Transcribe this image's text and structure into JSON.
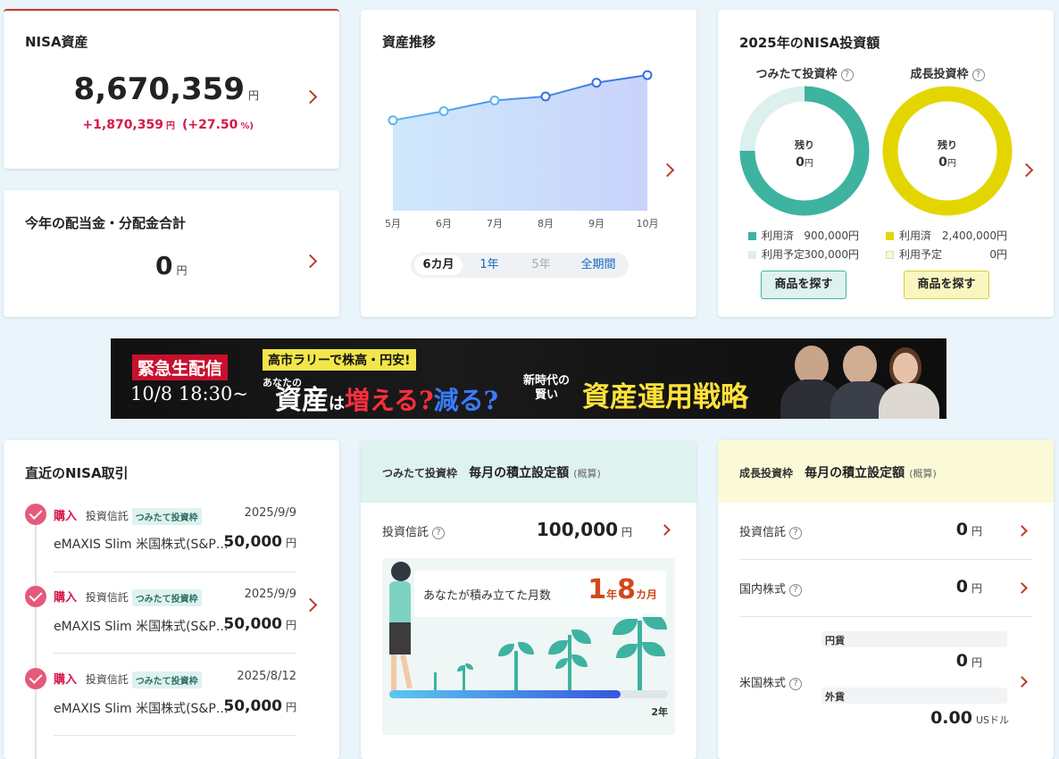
{
  "nisa_assets": {
    "title": "NISA資産",
    "amount": "8,670,359",
    "unit": "円",
    "gain": "+1,870,359",
    "gain_unit": "円",
    "gain_pct": "(+27.50",
    "gain_pct_unit": "%)"
  },
  "dividend": {
    "title": "今年の配当金・分配金合計",
    "amount": "0",
    "unit": "円"
  },
  "asset_trend": {
    "title": "資産推移",
    "tabs": [
      {
        "label": "6カ月",
        "state": "active"
      },
      {
        "label": "1年",
        "state": "link"
      },
      {
        "label": "5年",
        "state": "disabled"
      },
      {
        "label": "全期間",
        "state": "link"
      }
    ],
    "chart_data": {
      "type": "area",
      "categories": [
        "5月",
        "6月",
        "7月",
        "8月",
        "9月",
        "10月"
      ],
      "values": [
        7780000,
        7960000,
        8170000,
        8250000,
        8520000,
        8670359
      ],
      "ylim": [
        6000000,
        8900000
      ],
      "grid": false
    }
  },
  "investment_2025": {
    "title": "2025年のNISA投資額",
    "tsumitate": {
      "title": "つみたて投資枠",
      "remaining_label": "残り",
      "remaining_amount": "0",
      "remaining_unit": "円",
      "used_fraction": 0.75,
      "used_label": "利用済",
      "used_value": "900,000",
      "used_unit": "円",
      "planned_label": "利用予定",
      "planned_value": "300,000",
      "planned_unit": "円",
      "button": "商品を探す",
      "color": "#3db3a0",
      "planned_color": "#dcf0ed"
    },
    "seicho": {
      "title": "成長投資枠",
      "remaining_label": "残り",
      "remaining_amount": "0",
      "remaining_unit": "円",
      "used_fraction": 1.0,
      "used_label": "利用済",
      "used_value": "2,400,000",
      "used_unit": "円",
      "planned_label": "利用予定",
      "planned_value": "0",
      "planned_unit": "円",
      "button": "商品を探す",
      "color": "#e3d600",
      "planned_color": "#faf8d8"
    }
  },
  "banner": {
    "live": "緊急生配信",
    "datetime": "10/8 18:30~",
    "headline_tag": "高市ラリーで株高・円安!",
    "anata": "あなたの",
    "shisan": "資産",
    "wa": "は",
    "fueru": "増える?",
    "heru": "減る?",
    "shinjidai": "新時代の",
    "kashikoi": "賢い",
    "strategy": "資産運用戦略"
  },
  "recent_transactions": {
    "title": "直近のNISA取引",
    "items": [
      {
        "type": "購入",
        "category": "投資信託",
        "account": "つみたて投資枠",
        "date": "2025/9/9",
        "name": "eMAXIS Slim 米国株式(S&P…",
        "amount": "50,000",
        "unit": "円"
      },
      {
        "type": "購入",
        "category": "投資信託",
        "account": "つみたて投資枠",
        "date": "2025/9/9",
        "name": "eMAXIS Slim 米国株式(S&P…",
        "amount": "50,000",
        "unit": "円"
      },
      {
        "type": "購入",
        "category": "投資信託",
        "account": "つみたて投資枠",
        "date": "2025/8/12",
        "name": "eMAXIS Slim 米国株式(S&P…",
        "amount": "50,000",
        "unit": "円"
      }
    ]
  },
  "tsumitate_monthly": {
    "tag": "つみたて投資枠",
    "title": "毎月の積立設定額",
    "note": "(概算)",
    "row_label": "投資信託",
    "row_amount": "100,000",
    "row_unit": "円",
    "months_label": "あなたが積み立てた月数",
    "years": "1",
    "years_unit": "年",
    "months": "8",
    "months_unit": "カ月",
    "progress": 0.83,
    "progress_end_label": "2年"
  },
  "seicho_monthly": {
    "tag": "成長投資枠",
    "title": "毎月の積立設定額",
    "note": "(概算)",
    "rows": [
      {
        "label": "投資信託",
        "amount": "0",
        "unit": "円"
      },
      {
        "label": "国内株式",
        "amount": "0",
        "unit": "円"
      }
    ],
    "us": {
      "label": "米国株式",
      "yen_label": "円貨",
      "yen_amount": "0",
      "yen_unit": "円",
      "fx_label": "外貨",
      "fx_amount": "0.00",
      "fx_unit": "USドル"
    }
  }
}
